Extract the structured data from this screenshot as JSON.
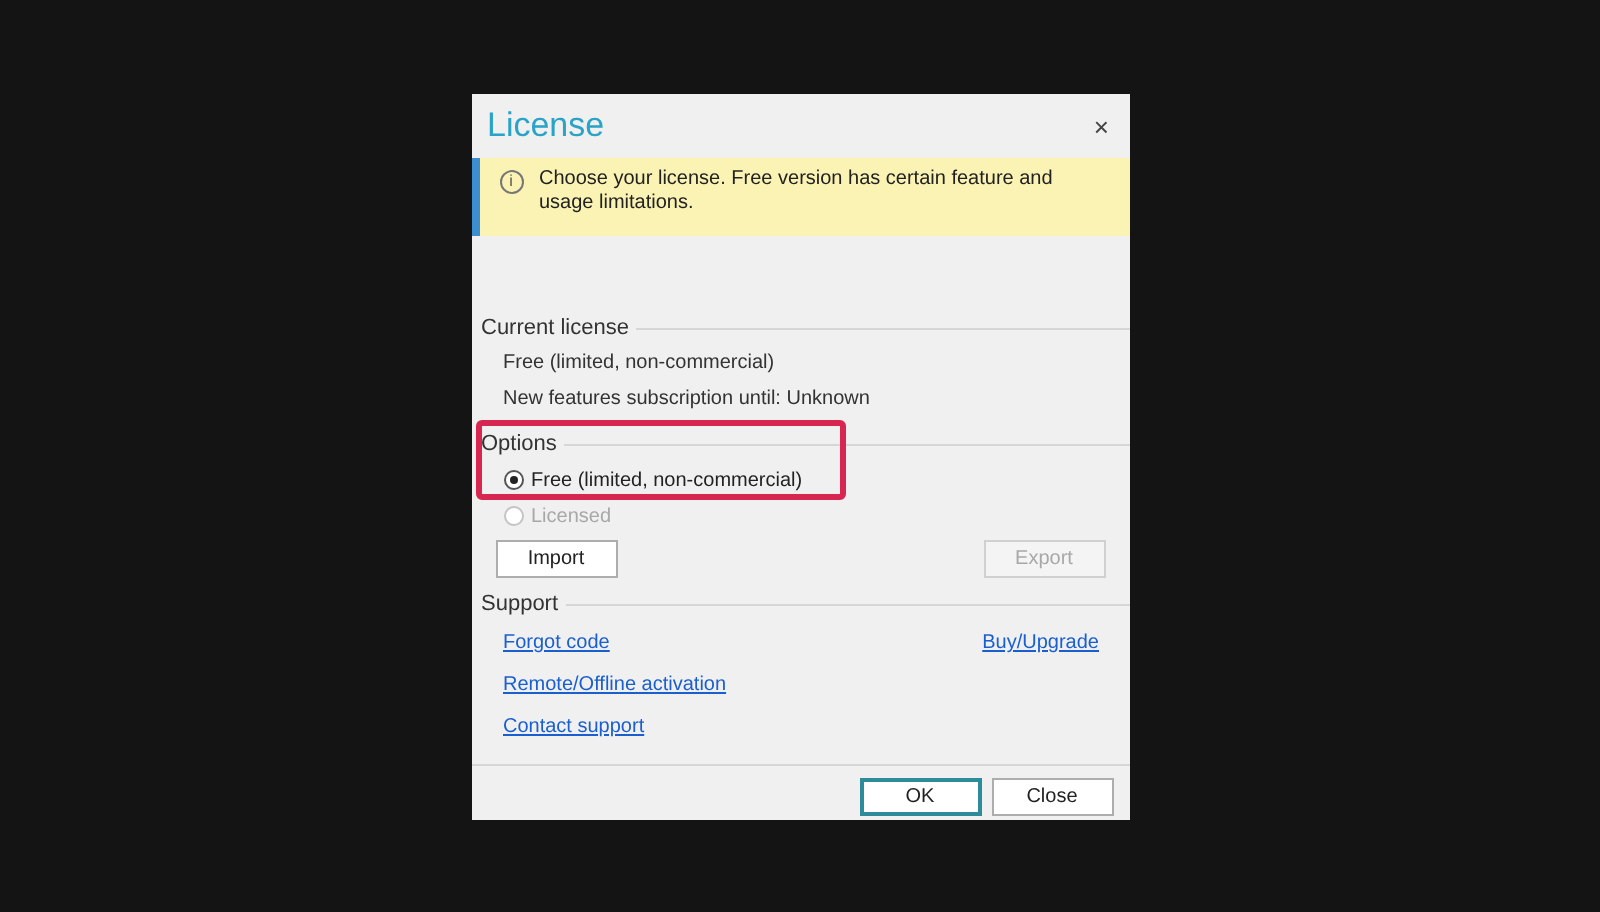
{
  "window": {
    "title": "License",
    "close": "×"
  },
  "banner": {
    "icon": "i",
    "text": "Choose your license. Free version has certain feature and usage limitations."
  },
  "current_license": {
    "heading": "Current license",
    "lines": [
      "Free (limited, non-commercial)",
      "New features subscription until: Unknown"
    ]
  },
  "options": {
    "heading": "Options",
    "highlighted": true,
    "radios": [
      {
        "label": "Free (limited, non-commercial)",
        "selected": true,
        "disabled": false
      },
      {
        "label": "Licensed",
        "selected": false,
        "disabled": true
      }
    ],
    "buttons": [
      {
        "label": "Import",
        "disabled": false
      },
      {
        "label": "Export",
        "disabled": true
      }
    ]
  },
  "support": {
    "heading": "Support",
    "links": [
      "Forgot code",
      "Remote/Offline activation",
      "Contact support"
    ],
    "side_link": "Buy/Upgrade"
  },
  "footer_buttons": [
    {
      "label": "OK",
      "default": true
    },
    {
      "label": "Close",
      "default": false
    }
  ]
}
